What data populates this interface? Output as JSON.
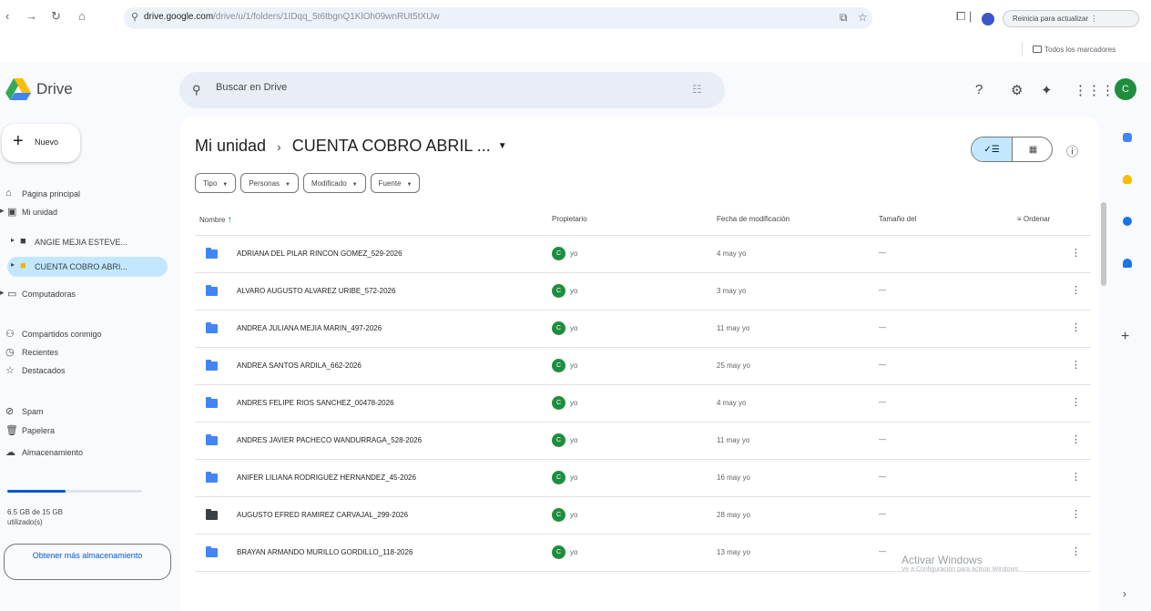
{
  "browser": {
    "url_host": "drive.google.com",
    "url_rest": "/drive/u/1/folders/1IDqq_5t6tbgnQ1KlOh09wnRUt5tXUw",
    "update_label": "Reinicia para actualizar",
    "bookmarks_label": "Todos los marcadores"
  },
  "header": {
    "app_name": "Drive",
    "search_placeholder": "Buscar en Drive",
    "avatar_letter": "C"
  },
  "sidebar": {
    "new_label": "Nuevo",
    "items": [
      {
        "label": "Página principal"
      },
      {
        "label": "Mi unidad"
      },
      {
        "label": "ANGIE MEJIA ESTEVE..."
      },
      {
        "label": "CUENTA COBRO ABRI..."
      },
      {
        "label": "Computadoras"
      },
      {
        "label": "Compartidos conmigo"
      },
      {
        "label": "Recientes"
      },
      {
        "label": "Destacados"
      },
      {
        "label": "Spam"
      },
      {
        "label": "Papelera"
      },
      {
        "label": "Almacenamiento"
      }
    ],
    "storage_fraction": 0.43,
    "storage_text": "6.5 GB de 15 GB utilizado(s)",
    "more_storage_label": "Obtener más almacenamiento"
  },
  "main": {
    "breadcrumb_root": "Mi unidad",
    "breadcrumb_current": "CUENTA COBRO ABRIL ...",
    "filters": [
      "Tipo",
      "Personas",
      "Modificado",
      "Fuente"
    ],
    "columns": {
      "name": "Nombre",
      "owner": "Propietario",
      "modified": "Fecha de modificación",
      "size": "Tamaño del",
      "sort": "Ordenar"
    },
    "rows": [
      {
        "name": "ADRIANA DEL PILAR RINCON GOMEZ_529-2026",
        "owner": "yo",
        "modified": "4 may yo",
        "size": "—",
        "color": "#4285f4"
      },
      {
        "name": "ALVARO AUGUSTO ALVAREZ URIBE_572-2026",
        "owner": "yo",
        "modified": "3 may yo",
        "size": "—",
        "color": "#4285f4"
      },
      {
        "name": "ANDREA JULIANA MEJIA MARIN_497-2026",
        "owner": "yo",
        "modified": "11 may yo",
        "size": "—",
        "color": "#4285f4"
      },
      {
        "name": "ANDREA SANTOS ARDILA_662-2026",
        "owner": "yo",
        "modified": "25 may yo",
        "size": "—",
        "color": "#4285f4"
      },
      {
        "name": "ANDRES FELIPE RIOS SANCHEZ_00478-2026",
        "owner": "yo",
        "modified": "4 may yo",
        "size": "—",
        "color": "#4285f4"
      },
      {
        "name": "ANDRES JAVIER PACHECO WANDURRAGA_528-2026",
        "owner": "yo",
        "modified": "11 may yo",
        "size": "—",
        "color": "#4285f4"
      },
      {
        "name": "ANIFER LILIANA RODRIGUEZ HERNANDEZ_45-2026",
        "owner": "yo",
        "modified": "16 may yo",
        "size": "—",
        "color": "#4285f4"
      },
      {
        "name": "AUGUSTO EFRED RAMIREZ CARVAJAL_299-2026",
        "owner": "yo",
        "modified": "28 may yo",
        "size": "—",
        "color": "#3c4043"
      },
      {
        "name": "BRAYAN ARMANDO MURILLO GORDILLO_118-2026",
        "owner": "yo",
        "modified": "13 may yo",
        "size": "—",
        "color": "#4285f4"
      }
    ]
  },
  "overlay": {
    "watermark_title": "Activar Windows",
    "watermark_sub": "Ve a Configuración para activar Windows."
  }
}
